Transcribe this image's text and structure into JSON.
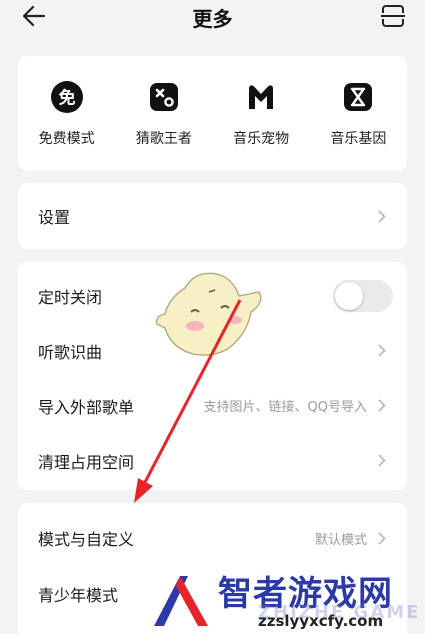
{
  "header": {
    "title": "更多",
    "back_icon": "arrow-left-icon",
    "scan_icon": "scan-icon"
  },
  "quick_entries": [
    {
      "label": "免费模式",
      "icon": "free-mode-icon",
      "glyph": "免"
    },
    {
      "label": "猜歌王者",
      "icon": "guess-song-icon"
    },
    {
      "label": "音乐宠物",
      "icon": "music-pet-icon"
    },
    {
      "label": "音乐基因",
      "icon": "music-gene-icon"
    }
  ],
  "settings": {
    "label": "设置"
  },
  "tools": {
    "timer_off": {
      "label": "定时关闭",
      "enabled": false
    },
    "song_recognition": {
      "label": "听歌识曲"
    },
    "import_playlist": {
      "label": "导入外部歌单",
      "hint": "支持图片、链接、QQ号导入"
    },
    "clean_storage": {
      "label": "清理占用空间"
    }
  },
  "modes": {
    "mode_custom": {
      "label": "模式与自定义",
      "hint": "默认模式"
    },
    "teen_mode": {
      "label": "青少年模式"
    }
  },
  "watermark": {
    "title": "智者游戏网",
    "sub": "ZHIZHE GAME",
    "url": "zzslyyxcfy.com"
  },
  "colors": {
    "background": "#f2f3f5",
    "card": "#ffffff",
    "arrow": "#e8242b",
    "watermark_blue": "#2c3aa8"
  }
}
